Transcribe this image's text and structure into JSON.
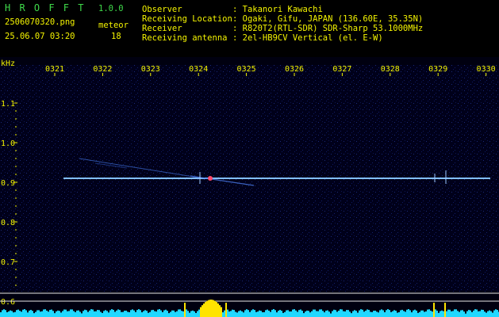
{
  "header": {
    "app_title": "H R O F F T",
    "version": "1.0.0",
    "filename": "2506070320.png",
    "date_time": "25.06.07 03:20",
    "meteor_label": "meteor",
    "meteor_count": "18",
    "info": [
      {
        "key": "Observer",
        "value": ": Takanori Kawachi"
      },
      {
        "key": "Receiving Location",
        "value": ": Ogaki, Gifu, JAPAN (136.60E, 35.35N)"
      },
      {
        "key": "Receiver",
        "value": ": R820T2(RTL-SDR) SDR-Sharp 53.1000MHz"
      },
      {
        "key": "Receiving antenna",
        "value": ": 2el-HB9CV Vertical (el. E-W)"
      }
    ]
  },
  "plot": {
    "y_unit": "kHz",
    "time_ticks": [
      "0321",
      "0322",
      "0323",
      "0324",
      "0325",
      "0326",
      "0327",
      "0328",
      "0329",
      "0330"
    ],
    "freq_ticks": [
      "1.1",
      "1.0",
      "0.9",
      "0.8",
      "0.7",
      "0.6"
    ],
    "colors": {
      "background": "#00001a",
      "trace": "#5fa8ff",
      "tick": "#f4f400",
      "level": "#20d8ff",
      "peak": "#ffe400"
    }
  }
}
